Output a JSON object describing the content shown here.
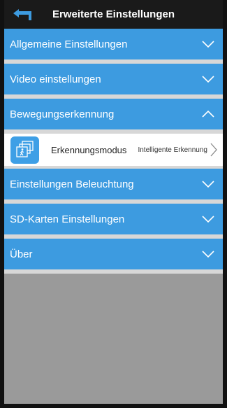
{
  "header": {
    "title": "Erweiterte Einstellungen",
    "back_icon": "back-arrow-icon"
  },
  "sections": [
    {
      "label": "Allgemeine Einstellungen",
      "expanded": false
    },
    {
      "label": "Video einstellungen",
      "expanded": false
    },
    {
      "label": "Bewegungserkennung",
      "expanded": true
    },
    {
      "label": "Einstellungen Beleuchtung",
      "expanded": false
    },
    {
      "label": "SD-Karten Einstellungen",
      "expanded": false
    },
    {
      "label": "Über",
      "expanded": false
    }
  ],
  "motion_detection": {
    "row_label": "Erkennungsmodus",
    "row_value": "Intelligente Erkennung",
    "icon": "motion-detection-mode-icon"
  },
  "colors": {
    "section_blue": "#3d9be0",
    "header_black": "#1a1a1a",
    "background_gray": "#9a9a9a"
  }
}
